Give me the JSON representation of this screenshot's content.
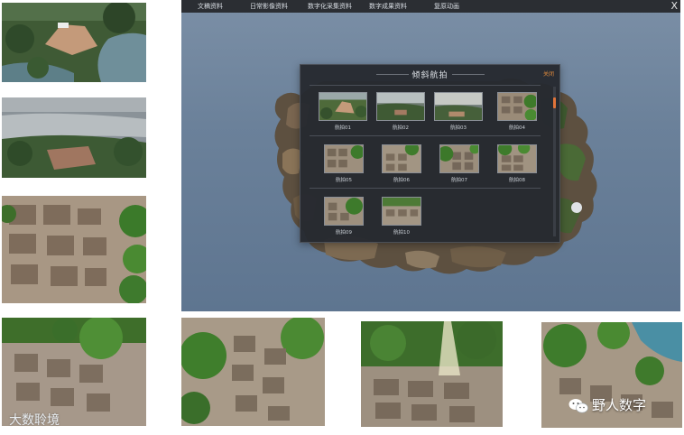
{
  "app": {
    "menu": [
      "文稿资料",
      "日常影像资料",
      "数字化采集资料",
      "数字成果资料",
      "复原动画"
    ],
    "close_glyph": "X"
  },
  "dialog": {
    "title": "倾斜航拍",
    "close_label": "关闭",
    "thumbnails": [
      "航拍01",
      "航拍02",
      "航拍03",
      "航拍04",
      "航拍05",
      "航拍06",
      "航拍07",
      "航拍08",
      "航拍09",
      "航拍10"
    ]
  },
  "watermarks": {
    "left": "大数聆境",
    "right": "野人数字"
  },
  "colors": {
    "accent": "#e0743a",
    "topbar": "#2b2e33",
    "app_background": "#6b819a",
    "dialog_background": "#262a30"
  }
}
